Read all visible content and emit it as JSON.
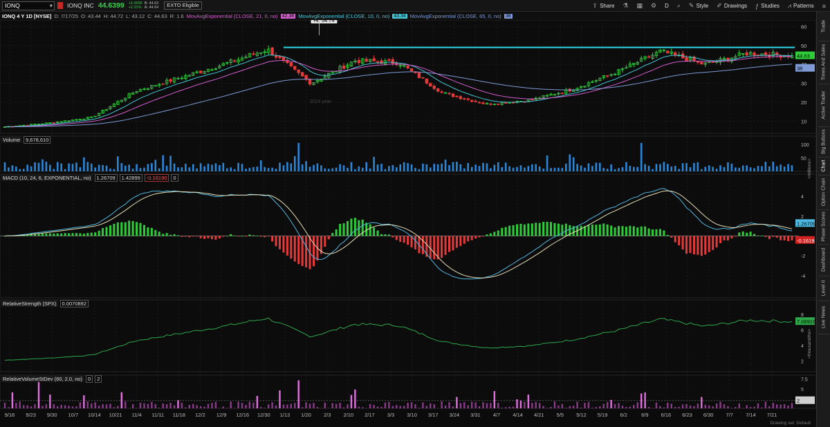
{
  "toolbar": {
    "symbol": "IONQ",
    "company": "IONQ INC",
    "last_price": "44.6399",
    "change_line1": "+1.0099",
    "change_line2": "+2.31%",
    "bid": "B: 44.63",
    "ask": "A: 44.64",
    "exto": "EXTO Eligible",
    "share": "Share",
    "d": "D",
    "style": "Style",
    "drawings": "Drawings",
    "studies": "Studies",
    "patterns": "Patterns"
  },
  "chart_header": {
    "title": "IONQ 4 Y 1D [NYSE]",
    "date": "D: 7/17/25",
    "open": "O: 43.44",
    "high": "H: 44.72",
    "low": "L: 43.12",
    "close": "C: 44.63",
    "range": "R: 1.6",
    "ma1_label": "MovAvgExponential (CLOSE, 21, 0, no)",
    "ma1_value": "42.38",
    "ma2_label": "MovAvgExponential (CLOSE, 10, 0, no)",
    "ma2_value": "43.34",
    "ma3_label": "MovAvgExponential (CLOSE, 65, 0, no)",
    "ma3_value": "38"
  },
  "price_panel": {
    "hi_label": "Hi: 54.74",
    "price_tag": "44.63",
    "ma3_tag": "38",
    "y_ticks": [
      "60",
      "50",
      "40",
      "30",
      "20",
      "10"
    ],
    "watermark": "2024 year"
  },
  "volume_panel": {
    "name": "Volume",
    "value": "9,678,610",
    "y_ticks": [
      "100",
      "50"
    ],
    "unit": "<millions>"
  },
  "macd_panel": {
    "name": "MACD (10, 24, 6, EXPONENTIAL, no)",
    "value": "1.26709",
    "avg": "1.42899",
    "diff": "-0.16190",
    "zero": "0",
    "y_ticks": [
      "4",
      "2",
      "-2",
      "-4"
    ],
    "tag_value": "1.26709",
    "tag_diff": "-0.1619"
  },
  "rs_panel": {
    "name": "RelativeStrength (SPX)",
    "value": "0.0070892",
    "y_ticks": [
      "8",
      "6",
      "4",
      "2"
    ],
    "tag": "7.08919",
    "unit": "<thousandths>"
  },
  "rvs_panel": {
    "name": "RelativeVolumeStDev (60, 2.0, no)",
    "v1": "0",
    "v2": "2",
    "y_ticks": [
      "7.5",
      "5",
      "2.5"
    ],
    "tag": "2"
  },
  "x_axis": {
    "labels": [
      "9/16",
      "9/23",
      "9/30",
      "10/7",
      "10/14",
      "10/21",
      "11/4",
      "11/11",
      "11/18",
      "12/2",
      "12/9",
      "12/16",
      "12/30",
      "1/13",
      "1/20",
      "2/3",
      "2/10",
      "2/17",
      "3/3",
      "3/10",
      "3/17",
      "3/24",
      "3/31",
      "4/7",
      "4/14",
      "4/21",
      "5/5",
      "5/12",
      "5/19",
      "6/2",
      "6/9",
      "6/16",
      "6/23",
      "6/30",
      "7/7",
      "7/14",
      "7/21"
    ]
  },
  "footer_note": "Drawing set: Default",
  "sidebar": {
    "items": [
      "Trade",
      "Times And Sales",
      "Active Trader",
      "Big Buttons",
      "Chart",
      "Option Chain",
      "Phase Scores",
      "Dashboard",
      "Level II",
      "Live News"
    ]
  },
  "colors": {
    "up": "#2fcc3a",
    "down": "#e53a3a",
    "ma1": "#d65fd0",
    "ma2": "#45c7d6",
    "ma3": "#7f9bd6",
    "resistance": "#2fd6e6",
    "volume": "#2b86d6",
    "macd_value": "#4fb8e0",
    "macd_avg": "#e8e0b8",
    "rs_line": "#2ea84a",
    "rvs_bar": "#e070e0"
  },
  "chart_data": {
    "type": "candlestick",
    "x_range": [
      "9/16",
      "7/21"
    ],
    "y_range": [
      5,
      62
    ],
    "resistance_level": 49,
    "high_marker": 54.74,
    "last_close": 44.63,
    "approx_close_path": [
      {
        "date": "9/16",
        "close": 7
      },
      {
        "date": "10/7",
        "close": 9
      },
      {
        "date": "10/21",
        "close": 12
      },
      {
        "date": "11/11",
        "close": 26
      },
      {
        "date": "12/2",
        "close": 33
      },
      {
        "date": "12/16",
        "close": 40
      },
      {
        "date": "12/30",
        "close": 48
      },
      {
        "date": "1/13",
        "close": 30
      },
      {
        "date": "1/20",
        "close": 42
      },
      {
        "date": "2/10",
        "close": 41
      },
      {
        "date": "3/3",
        "close": 25
      },
      {
        "date": "3/10",
        "close": 19
      },
      {
        "date": "4/7",
        "close": 21
      },
      {
        "date": "4/21",
        "close": 27
      },
      {
        "date": "5/19",
        "close": 36
      },
      {
        "date": "5/26",
        "close": 47
      },
      {
        "date": "6/9",
        "close": 40
      },
      {
        "date": "7/7",
        "close": 46
      },
      {
        "date": "7/17",
        "close": 44.63
      }
    ]
  }
}
